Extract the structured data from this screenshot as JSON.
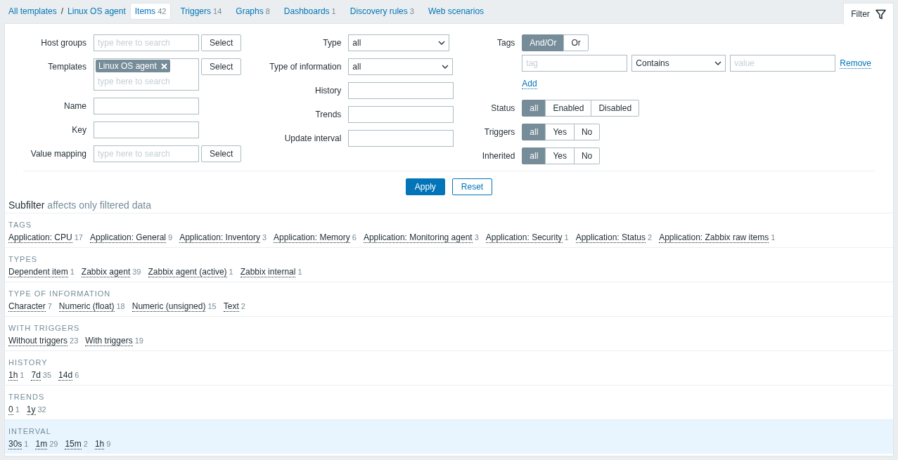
{
  "breadcrumbs": [
    {
      "label": "All templates"
    },
    {
      "label": "Linux OS agent"
    }
  ],
  "breadcrumb_separator": "/",
  "nav_tabs": [
    {
      "label": "Items",
      "count": "42",
      "selected": true
    },
    {
      "label": "Triggers",
      "count": "14",
      "selected": false
    },
    {
      "label": "Graphs",
      "count": "8",
      "selected": false
    },
    {
      "label": "Dashboards",
      "count": "1",
      "selected": false
    },
    {
      "label": "Discovery rules",
      "count": "3",
      "selected": false
    },
    {
      "label": "Web scenarios",
      "selected": false
    }
  ],
  "filter_tab": {
    "label": "Filter"
  },
  "filter": {
    "columns": [
      {
        "fields": [
          {
            "label": "Host groups",
            "kind": "multiselect",
            "placeholder": "type here to search",
            "button": "Select"
          },
          {
            "label": "Templates",
            "kind": "multiselect",
            "chips": [
              {
                "label": "Linux OS agent"
              }
            ],
            "placeholder": "type here to search",
            "button": "Select"
          },
          {
            "label": "Name",
            "kind": "text"
          },
          {
            "label": "Key",
            "kind": "text"
          },
          {
            "label": "Value mapping",
            "kind": "multiselect",
            "placeholder": "type here to search",
            "button": "Select"
          }
        ]
      },
      {
        "fields": [
          {
            "label": "Type",
            "kind": "select",
            "value": "all"
          },
          {
            "label": "Type of information",
            "kind": "select",
            "value": "all"
          },
          {
            "label": "History",
            "kind": "text"
          },
          {
            "label": "Trends",
            "kind": "text"
          },
          {
            "label": "Update interval",
            "kind": "text"
          }
        ]
      },
      {
        "fields": [
          {
            "label": "Tags",
            "kind": "tags",
            "options": [
              {
                "label": "And/Or",
                "selected": true
              },
              {
                "label": "Or",
                "selected": false
              }
            ],
            "rows": [
              {
                "tag_placeholder": "tag",
                "operator": "Contains",
                "value_placeholder": "value",
                "remove": "Remove"
              }
            ],
            "add": "Add"
          },
          {
            "label": "Status",
            "kind": "segmented",
            "options": [
              {
                "label": "all",
                "selected": true
              },
              {
                "label": "Enabled",
                "selected": false
              },
              {
                "label": "Disabled",
                "selected": false
              }
            ]
          },
          {
            "label": "Triggers",
            "kind": "segmented",
            "options": [
              {
                "label": "all",
                "selected": true
              },
              {
                "label": "Yes",
                "selected": false
              },
              {
                "label": "No",
                "selected": false
              }
            ]
          },
          {
            "label": "Inherited",
            "kind": "segmented",
            "options": [
              {
                "label": "all",
                "selected": true
              },
              {
                "label": "Yes",
                "selected": false
              },
              {
                "label": "No",
                "selected": false
              }
            ]
          }
        ]
      }
    ],
    "actions": [
      {
        "label": "Apply",
        "kind": "primary"
      },
      {
        "label": "Reset",
        "kind": "secondary"
      }
    ]
  },
  "subfilter": {
    "title": "Subfilter",
    "hint": "affects only filtered data",
    "sections": [
      {
        "title": "TAGS",
        "highlighted": false,
        "items": [
          {
            "label": "Application: CPU",
            "count": "17"
          },
          {
            "label": "Application: General",
            "count": "9"
          },
          {
            "label": "Application: Inventory",
            "count": "3"
          },
          {
            "label": "Application: Memory",
            "count": "6"
          },
          {
            "label": "Application: Monitoring agent",
            "count": "3"
          },
          {
            "label": "Application: Security",
            "count": "1"
          },
          {
            "label": "Application: Status",
            "count": "2"
          },
          {
            "label": "Application: Zabbix raw items",
            "count": "1"
          }
        ]
      },
      {
        "title": "TYPES",
        "highlighted": false,
        "items": [
          {
            "label": "Dependent item",
            "count": "1"
          },
          {
            "label": "Zabbix agent",
            "count": "39"
          },
          {
            "label": "Zabbix agent (active)",
            "count": "1"
          },
          {
            "label": "Zabbix internal",
            "count": "1"
          }
        ]
      },
      {
        "title": "TYPE OF INFORMATION",
        "highlighted": false,
        "items": [
          {
            "label": "Character",
            "count": "7"
          },
          {
            "label": "Numeric (float)",
            "count": "18"
          },
          {
            "label": "Numeric (unsigned)",
            "count": "15"
          },
          {
            "label": "Text",
            "count": "2"
          }
        ]
      },
      {
        "title": "WITH TRIGGERS",
        "highlighted": false,
        "items": [
          {
            "label": "Without triggers",
            "count": "23"
          },
          {
            "label": "With triggers",
            "count": "19"
          }
        ]
      },
      {
        "title": "HISTORY",
        "highlighted": false,
        "items": [
          {
            "label": "1h",
            "count": "1"
          },
          {
            "label": "7d",
            "count": "35"
          },
          {
            "label": "14d",
            "count": "6"
          }
        ]
      },
      {
        "title": "TRENDS",
        "highlighted": false,
        "items": [
          {
            "label": "0",
            "count": "1"
          },
          {
            "label": "1y",
            "count": "32"
          }
        ]
      },
      {
        "title": "INTERVAL",
        "highlighted": true,
        "items": [
          {
            "label": "30s",
            "count": "1"
          },
          {
            "label": "1m",
            "count": "29"
          },
          {
            "label": "15m",
            "count": "2"
          },
          {
            "label": "1h",
            "count": "9"
          }
        ]
      }
    ]
  }
}
